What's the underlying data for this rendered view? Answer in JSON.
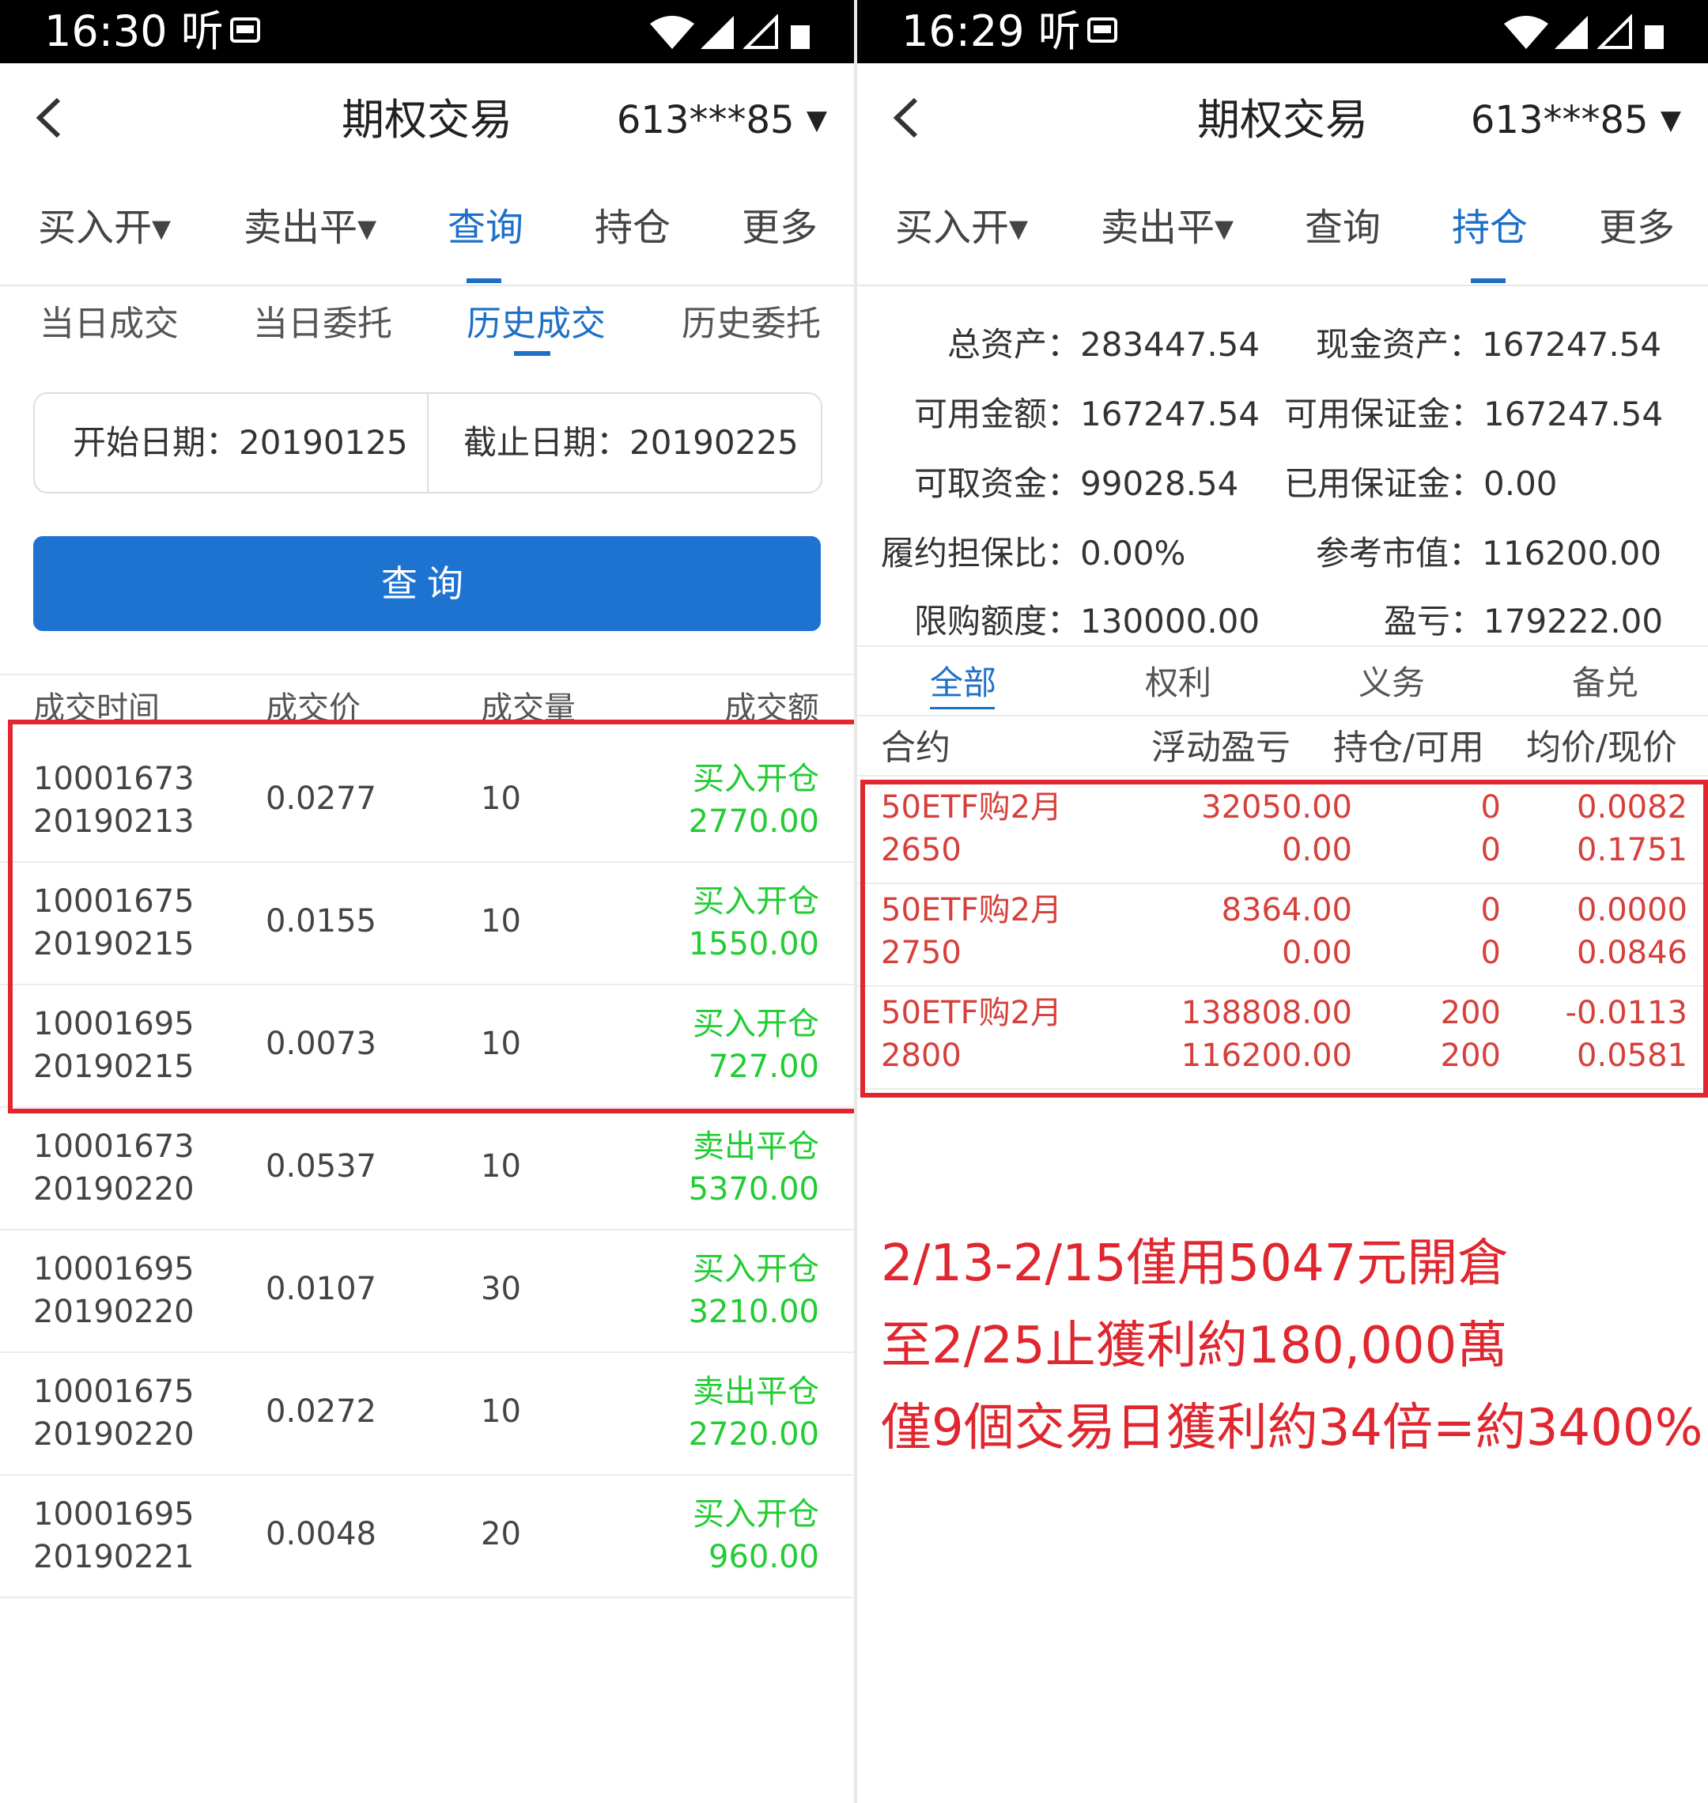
{
  "left": {
    "status": {
      "time": "16:30 听"
    },
    "header": {
      "title": "期权交易",
      "account": "613***85"
    },
    "tabs": [
      "买入开▾",
      "卖出平▾",
      "查询",
      "持仓",
      "更多"
    ],
    "subtabs": [
      "当日成交",
      "当日委托",
      "历史成交",
      "历史委托"
    ],
    "date_start": "开始日期：20190125",
    "date_end": "截止日期：20190225",
    "query_button": "查询",
    "columns": [
      "成交时间",
      "成交价",
      "成交量",
      "成交额"
    ],
    "rows": [
      {
        "code": "10001673",
        "date": "20190213",
        "price": "0.0277",
        "qty": "10",
        "action": "买入开仓",
        "amount": "2770.00"
      },
      {
        "code": "10001675",
        "date": "20190215",
        "price": "0.0155",
        "qty": "10",
        "action": "买入开仓",
        "amount": "1550.00"
      },
      {
        "code": "10001695",
        "date": "20190215",
        "price": "0.0073",
        "qty": "10",
        "action": "买入开仓",
        "amount": "727.00"
      },
      {
        "code": "10001673",
        "date": "20190220",
        "price": "0.0537",
        "qty": "10",
        "action": "卖出平仓",
        "amount": "5370.00"
      },
      {
        "code": "10001695",
        "date": "20190220",
        "price": "0.0107",
        "qty": "30",
        "action": "买入开仓",
        "amount": "3210.00"
      },
      {
        "code": "10001675",
        "date": "20190220",
        "price": "0.0272",
        "qty": "10",
        "action": "卖出平仓",
        "amount": "2720.00"
      },
      {
        "code": "10001695",
        "date": "20190221",
        "price": "0.0048",
        "qty": "20",
        "action": "买入开仓",
        "amount": "960.00"
      }
    ]
  },
  "right": {
    "status": {
      "time": "16:29 听"
    },
    "header": {
      "title": "期权交易",
      "account": "613***85"
    },
    "tabs": [
      "买入开▾",
      "卖出平▾",
      "查询",
      "持仓",
      "更多"
    ],
    "summary": {
      "total_assets": "总资产：283447.54",
      "cash_assets": "现金资产：167247.54",
      "available": "可用金额：167247.54",
      "avail_margin": "可用保证金：167247.54",
      "withdrawable": "可取资金：99028.54",
      "used_margin": "已用保证金：0.00",
      "guarantee_ratio": "履约担保比：0.00%",
      "ref_market_value": "参考市值：116200.00",
      "purchase_limit": "限购额度：130000.00",
      "pnl": "盈亏：179222.00"
    },
    "filters": [
      "全部",
      "权利",
      "义务",
      "备兑"
    ],
    "columns": [
      "合约",
      "浮动盈亏",
      "持仓/可用",
      "均价/现价"
    ],
    "positions": [
      {
        "name": "50ETF购2月",
        "strike": "2650",
        "float_pnl": "32050.00",
        "market": "0.00",
        "hold": "0",
        "avail": "0",
        "avg": "0.0082",
        "last": "0.1751"
      },
      {
        "name": "50ETF购2月",
        "strike": "2750",
        "float_pnl": "8364.00",
        "market": "0.00",
        "hold": "0",
        "avail": "0",
        "avg": "0.0000",
        "last": "0.0846"
      },
      {
        "name": "50ETF购2月",
        "strike": "2800",
        "float_pnl": "138808.00",
        "market": "116200.00",
        "hold": "200",
        "avail": "200",
        "avg": "-0.0113",
        "last": "0.0581"
      }
    ],
    "annotation": [
      "2/13-2/15僅用5047元開倉",
      "至2/25止獲利約180,000萬",
      "僅9個交易日獲利約34倍=約3400%"
    ]
  },
  "colors": {
    "accent": "#1e6fc8",
    "button": "#1e73d1",
    "trade_green": "#22cc33",
    "position_red": "#d6403b",
    "highlight_red": "#e0262e"
  }
}
